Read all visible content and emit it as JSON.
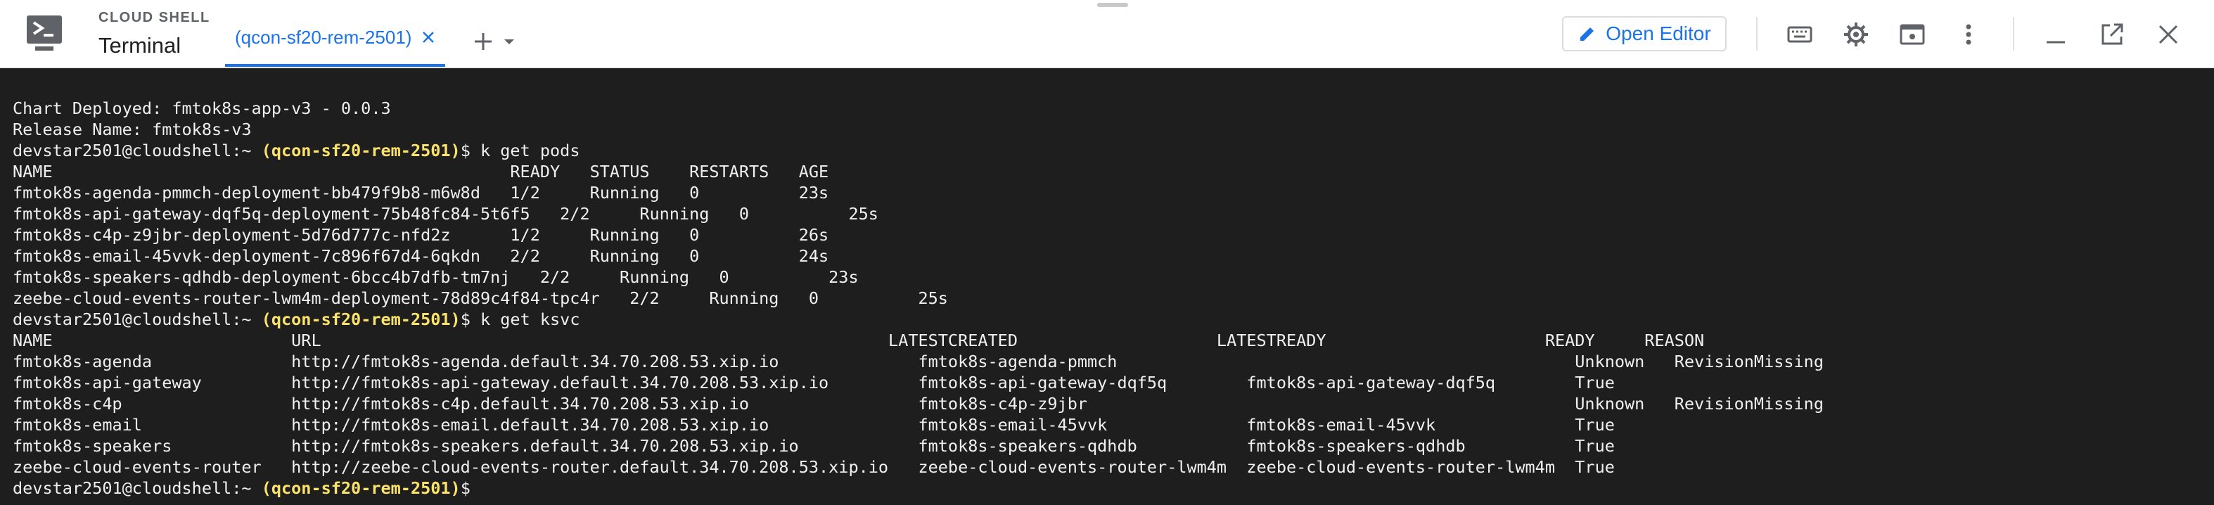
{
  "header": {
    "sup_title": "CLOUD SHELL",
    "title": "Terminal",
    "tab_label": "(qcon-sf20-rem-2501)",
    "open_editor_label": "Open Editor",
    "accent_color": "#1a73e8",
    "icons": [
      "cloud-shell-logo-icon",
      "close-icon",
      "plus-icon",
      "caret-down-icon",
      "pencil-icon",
      "keyboard-icon",
      "gear-icon",
      "web-preview-icon",
      "more-vert-icon",
      "minimize-icon",
      "open-in-new-icon",
      "close-icon"
    ]
  },
  "terminal": {
    "lines": [
      {
        "text": "Chart Deployed: fmtok8s-app-v3 - 0.0.3"
      },
      {
        "text": "Release Name: fmtok8s-v3"
      },
      {
        "user": "devstar2501@cloudshell:~ ",
        "project": "(qcon-sf20-rem-2501)",
        "cmd": "$ k get pods"
      },
      {
        "text": "NAME                                              READY   STATUS    RESTARTS   AGE"
      },
      {
        "text": "fmtok8s-agenda-pmmch-deployment-bb479f9b8-m6w8d   1/2     Running   0          23s"
      },
      {
        "text": "fmtok8s-api-gateway-dqf5q-deployment-75b48fc84-5t6f5   2/2     Running   0          25s"
      },
      {
        "text": "fmtok8s-c4p-z9jbr-deployment-5d76d777c-nfd2z      1/2     Running   0          26s"
      },
      {
        "text": "fmtok8s-email-45vvk-deployment-7c896f67d4-6qkdn   2/2     Running   0          24s"
      },
      {
        "text": "fmtok8s-speakers-qdhdb-deployment-6bcc4b7dfb-tm7nj   2/2     Running   0          23s"
      },
      {
        "text": "zeebe-cloud-events-router-lwm4m-deployment-78d89c4f84-tpc4r   2/2     Running   0          25s"
      },
      {
        "user": "devstar2501@cloudshell:~ ",
        "project": "(qcon-sf20-rem-2501)",
        "cmd": "$ k get ksvc"
      },
      {
        "text": "NAME                        URL                                                         LATESTCREATED                    LATESTREADY                      READY     REASON"
      },
      {
        "text": "fmtok8s-agenda              http://fmtok8s-agenda.default.34.70.208.53.xip.io              fmtok8s-agenda-pmmch                                              Unknown   RevisionMissing"
      },
      {
        "text": "fmtok8s-api-gateway         http://fmtok8s-api-gateway.default.34.70.208.53.xip.io         fmtok8s-api-gateway-dqf5q        fmtok8s-api-gateway-dqf5q        True"
      },
      {
        "text": "fmtok8s-c4p                 http://fmtok8s-c4p.default.34.70.208.53.xip.io                 fmtok8s-c4p-z9jbr                                                 Unknown   RevisionMissing"
      },
      {
        "text": "fmtok8s-email               http://fmtok8s-email.default.34.70.208.53.xip.io               fmtok8s-email-45vvk              fmtok8s-email-45vvk              True"
      },
      {
        "text": "fmtok8s-speakers            http://fmtok8s-speakers.default.34.70.208.53.xip.io            fmtok8s-speakers-qdhdb           fmtok8s-speakers-qdhdb           True"
      },
      {
        "text": "zeebe-cloud-events-router   http://zeebe-cloud-events-router.default.34.70.208.53.xip.io   zeebe-cloud-events-router-lwm4m  zeebe-cloud-events-router-lwm4m  True"
      },
      {
        "user": "devstar2501@cloudshell:~ ",
        "project": "(qcon-sf20-rem-2501)",
        "cmd": "$"
      }
    ],
    "prompt_color": "#fbe36b",
    "background": "#1e1e1e",
    "foreground": "#f0f0f0"
  }
}
